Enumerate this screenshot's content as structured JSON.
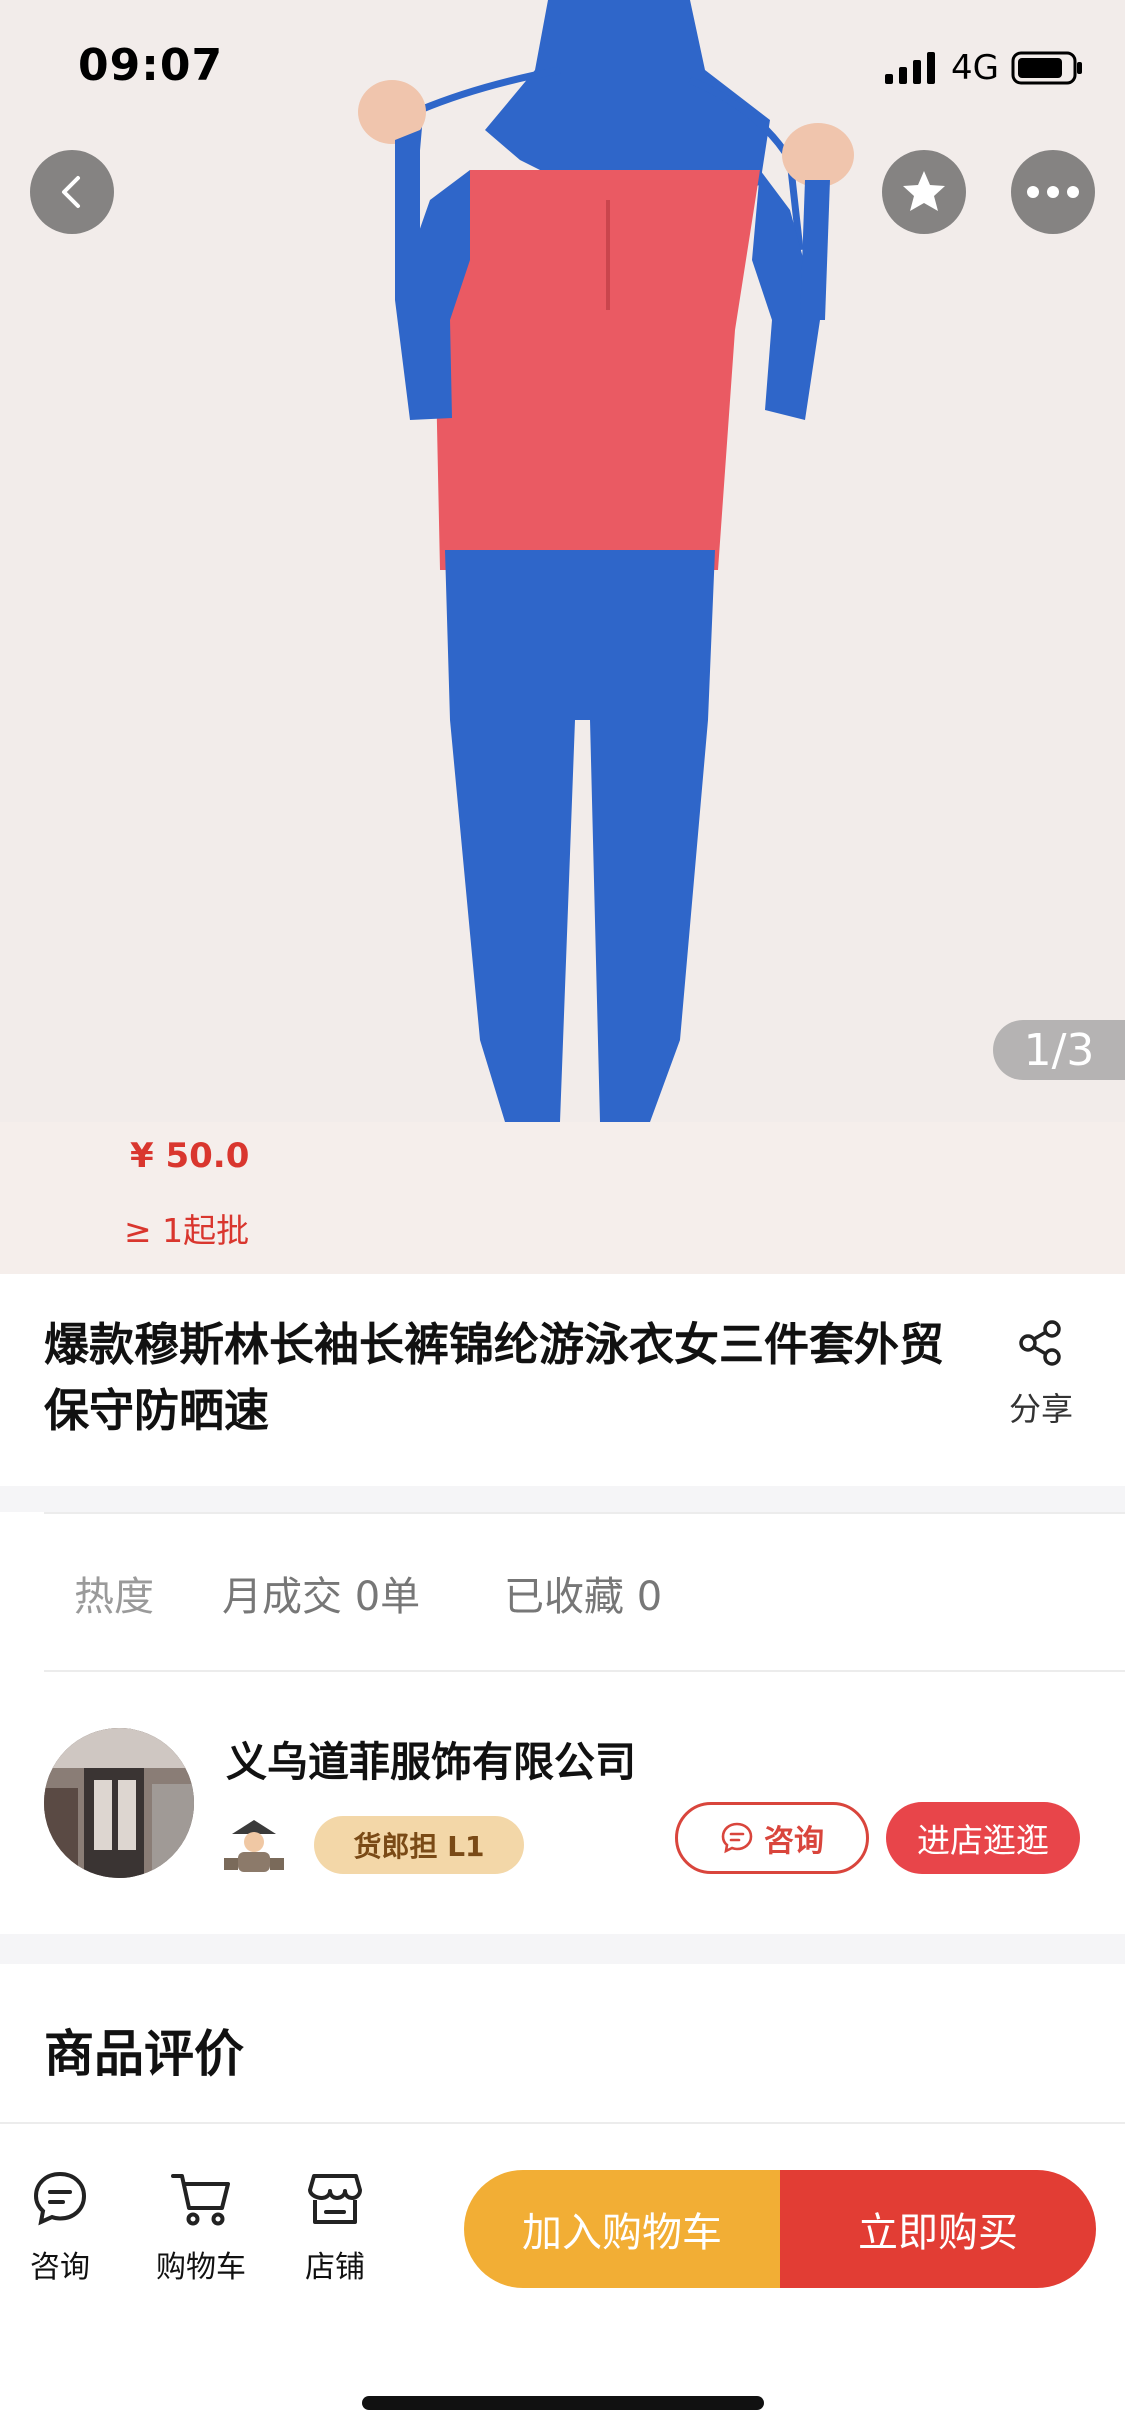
{
  "status_bar": {
    "time": "09:07",
    "network": "4G"
  },
  "gallery": {
    "counter": "1/3"
  },
  "price": {
    "amount": "¥ 50.0",
    "min_batch": "≥ 1起批"
  },
  "product": {
    "title": "爆款穆斯林长袖长裤锦纶游泳衣女三件套外贸保守防晒速"
  },
  "share": {
    "label": "分享"
  },
  "stats": {
    "heat": "热度",
    "monthly": "月成交 0单",
    "favorites": "已收藏 0"
  },
  "shop": {
    "name": "义乌道菲服饰有限公司",
    "level": "货郎担 L1",
    "consult_label": "咨询",
    "enter_label": "进店逛逛"
  },
  "reviews": {
    "title": "商品评价"
  },
  "tabbar": {
    "consult": "咨询",
    "cart": "购物车",
    "store": "店铺",
    "add_to_cart": "加入购物车",
    "buy_now": "立即购买"
  },
  "colors": {
    "accent_red": "#e23d34",
    "cart_orange": "#f2ae35",
    "price_red": "#d9362e",
    "badge_gold": "#f3d7a8"
  },
  "icons": [
    "back-icon",
    "star-icon",
    "more-icon",
    "share-icon",
    "chat-icon",
    "cart-icon",
    "store-icon",
    "signal-icon",
    "battery-icon"
  ]
}
